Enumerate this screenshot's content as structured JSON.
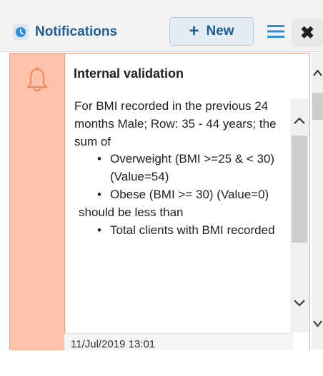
{
  "header": {
    "title": "Notifications",
    "new_label": "New"
  },
  "notification": {
    "title": "Internal validation",
    "intro": "For BMI recorded in the previous 24 months Male; Row: 35 - 44 years; the sum of",
    "items": [
      "Overweight (BMI >=25 & < 30) (Value=54)",
      "Obese (BMI >= 30) (Value=0)"
    ],
    "after": "should be less than",
    "items2": [
      "Total clients with BMI recorded"
    ],
    "timestamp": "11/Jul/2019 13:01"
  },
  "colors": {
    "accent": "#1f5d93",
    "severity_fill": "#ffc2ad",
    "severity_border": "#f0a084",
    "bell": "#f08a5d"
  },
  "icons": {
    "brand": "notification-badge-icon",
    "bell": "bell-icon",
    "menu": "hamburger-icon",
    "close": "close-icon"
  }
}
